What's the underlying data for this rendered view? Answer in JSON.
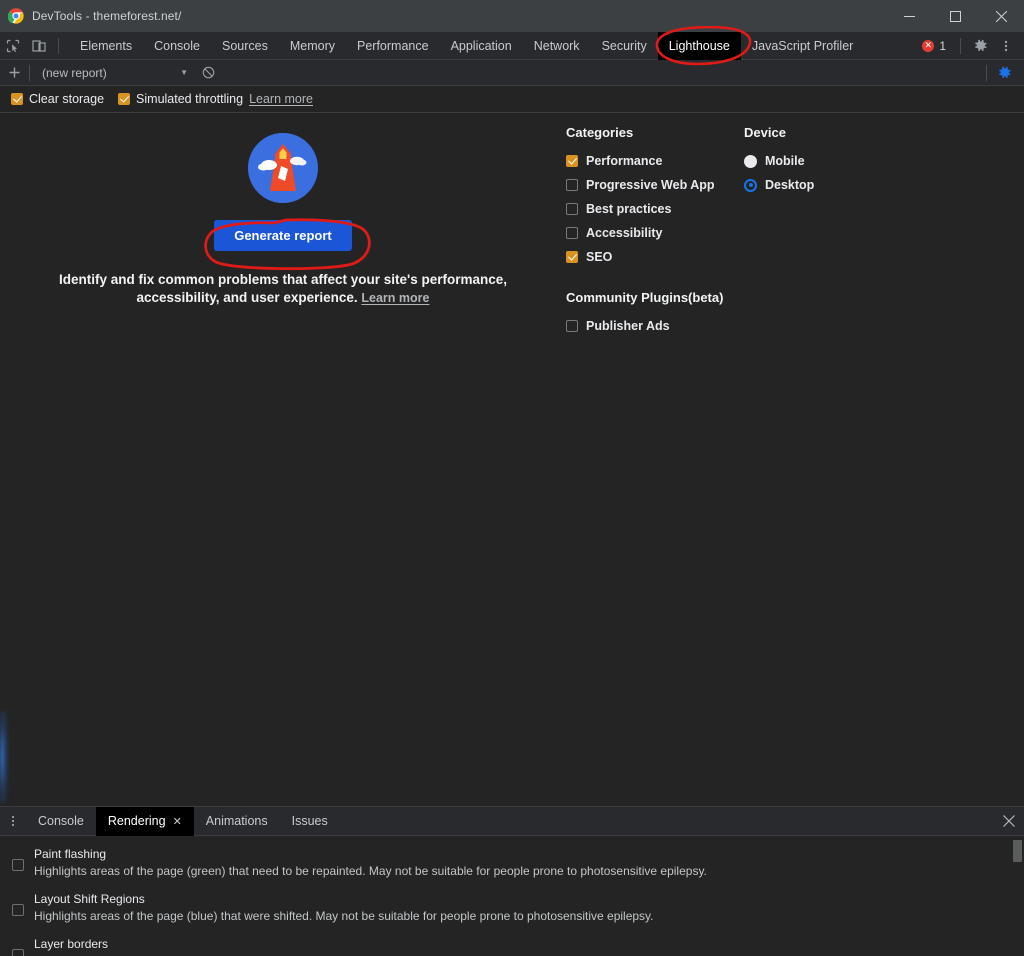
{
  "window": {
    "title": "DevTools - themeforest.net/",
    "logo_icon": "chrome-logo",
    "controls": {
      "minimize": "minimize-icon",
      "maximize": "maximize-icon",
      "close": "close-icon"
    }
  },
  "tabbar": {
    "inspect_icon": "inspect-element-icon",
    "device_icon": "device-toolbar-icon",
    "tabs": [
      {
        "label": "Elements",
        "active": false
      },
      {
        "label": "Console",
        "active": false
      },
      {
        "label": "Sources",
        "active": false
      },
      {
        "label": "Memory",
        "active": false
      },
      {
        "label": "Performance",
        "active": false
      },
      {
        "label": "Application",
        "active": false
      },
      {
        "label": "Network",
        "active": false
      },
      {
        "label": "Security",
        "active": false
      },
      {
        "label": "Lighthouse",
        "active": true
      },
      {
        "label": "JavaScript Profiler",
        "active": false
      }
    ],
    "error_count": "1",
    "error_icon": "error-badge-icon",
    "settings_icon": "gear-icon",
    "more_icon": "more-vertical-icon"
  },
  "lighthouse_toolbar": {
    "add_icon": "plus-icon",
    "report_name": "(new report)",
    "dropdown_icon": "chevron-down-icon",
    "clear_icon": "clear-ban-icon",
    "settings_icon": "gear-icon"
  },
  "options": {
    "clear_storage": {
      "label": "Clear storage",
      "checked": true
    },
    "simulated_throttling": {
      "label": "Simulated throttling",
      "checked": true
    },
    "learn_more": "Learn more"
  },
  "start_view": {
    "logo_icon": "lighthouse-logo",
    "generate_button": "Generate report",
    "description_line1": "Identify and fix common problems that affect your site's performance,",
    "description_line2": "accessibility, and user experience.",
    "learn_more": "Learn more"
  },
  "categories": {
    "heading": "Categories",
    "items": [
      {
        "label": "Performance",
        "checked": true
      },
      {
        "label": "Progressive Web App",
        "checked": false
      },
      {
        "label": "Best practices",
        "checked": false
      },
      {
        "label": "Accessibility",
        "checked": false
      },
      {
        "label": "SEO",
        "checked": true
      }
    ]
  },
  "community_plugins": {
    "heading": "Community Plugins(beta)",
    "items": [
      {
        "label": "Publisher Ads",
        "checked": false
      }
    ]
  },
  "device": {
    "heading": "Device",
    "options": [
      {
        "label": "Mobile",
        "selected": false
      },
      {
        "label": "Desktop",
        "selected": true
      }
    ]
  },
  "drawer": {
    "menu_icon": "more-vertical-icon",
    "tabs": [
      {
        "label": "Console",
        "active": false,
        "closable": false
      },
      {
        "label": "Rendering",
        "active": true,
        "closable": true
      },
      {
        "label": "Animations",
        "active": false,
        "closable": false
      },
      {
        "label": "Issues",
        "active": false,
        "closable": false
      }
    ],
    "close_icon": "close-icon",
    "rendering_options": [
      {
        "title": "Paint flashing",
        "description": "Highlights areas of the page (green) that need to be repainted. May not be suitable for people prone to photosensitive epilepsy.",
        "checked": false
      },
      {
        "title": "Layout Shift Regions",
        "description": "Highlights areas of the page (blue) that were shifted. May not be suitable for people prone to photosensitive epilepsy.",
        "checked": false
      },
      {
        "title": "Layer borders",
        "description": "",
        "checked": false
      }
    ]
  },
  "annotations": {
    "color": "#e01b17",
    "items": [
      {
        "target": "lighthouse-tab",
        "shape": "ellipse"
      },
      {
        "target": "generate-report-button",
        "shape": "rounded-rect"
      }
    ]
  },
  "colors": {
    "accent_blue": "#1a56d6",
    "checkbox_orange": "#d99325",
    "radio_blue": "#1a73e8",
    "error_red": "#e23d32",
    "background": "#242424",
    "toolbar_background": "#292a2d",
    "titlebar_background": "#3c4043",
    "annotation_red": "#e01b17"
  }
}
